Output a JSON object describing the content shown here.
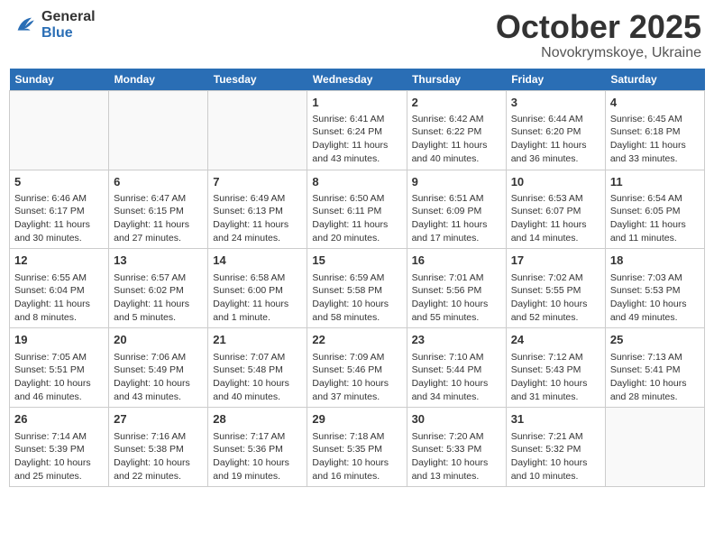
{
  "header": {
    "logo_general": "General",
    "logo_blue": "Blue",
    "month": "October 2025",
    "location": "Novokrymskoye, Ukraine"
  },
  "weekdays": [
    "Sunday",
    "Monday",
    "Tuesday",
    "Wednesday",
    "Thursday",
    "Friday",
    "Saturday"
  ],
  "weeks": [
    [
      {
        "day": "",
        "sunrise": "",
        "sunset": "",
        "daylight": ""
      },
      {
        "day": "",
        "sunrise": "",
        "sunset": "",
        "daylight": ""
      },
      {
        "day": "",
        "sunrise": "",
        "sunset": "",
        "daylight": ""
      },
      {
        "day": "1",
        "sunrise": "Sunrise: 6:41 AM",
        "sunset": "Sunset: 6:24 PM",
        "daylight": "Daylight: 11 hours and 43 minutes."
      },
      {
        "day": "2",
        "sunrise": "Sunrise: 6:42 AM",
        "sunset": "Sunset: 6:22 PM",
        "daylight": "Daylight: 11 hours and 40 minutes."
      },
      {
        "day": "3",
        "sunrise": "Sunrise: 6:44 AM",
        "sunset": "Sunset: 6:20 PM",
        "daylight": "Daylight: 11 hours and 36 minutes."
      },
      {
        "day": "4",
        "sunrise": "Sunrise: 6:45 AM",
        "sunset": "Sunset: 6:18 PM",
        "daylight": "Daylight: 11 hours and 33 minutes."
      }
    ],
    [
      {
        "day": "5",
        "sunrise": "Sunrise: 6:46 AM",
        "sunset": "Sunset: 6:17 PM",
        "daylight": "Daylight: 11 hours and 30 minutes."
      },
      {
        "day": "6",
        "sunrise": "Sunrise: 6:47 AM",
        "sunset": "Sunset: 6:15 PM",
        "daylight": "Daylight: 11 hours and 27 minutes."
      },
      {
        "day": "7",
        "sunrise": "Sunrise: 6:49 AM",
        "sunset": "Sunset: 6:13 PM",
        "daylight": "Daylight: 11 hours and 24 minutes."
      },
      {
        "day": "8",
        "sunrise": "Sunrise: 6:50 AM",
        "sunset": "Sunset: 6:11 PM",
        "daylight": "Daylight: 11 hours and 20 minutes."
      },
      {
        "day": "9",
        "sunrise": "Sunrise: 6:51 AM",
        "sunset": "Sunset: 6:09 PM",
        "daylight": "Daylight: 11 hours and 17 minutes."
      },
      {
        "day": "10",
        "sunrise": "Sunrise: 6:53 AM",
        "sunset": "Sunset: 6:07 PM",
        "daylight": "Daylight: 11 hours and 14 minutes."
      },
      {
        "day": "11",
        "sunrise": "Sunrise: 6:54 AM",
        "sunset": "Sunset: 6:05 PM",
        "daylight": "Daylight: 11 hours and 11 minutes."
      }
    ],
    [
      {
        "day": "12",
        "sunrise": "Sunrise: 6:55 AM",
        "sunset": "Sunset: 6:04 PM",
        "daylight": "Daylight: 11 hours and 8 minutes."
      },
      {
        "day": "13",
        "sunrise": "Sunrise: 6:57 AM",
        "sunset": "Sunset: 6:02 PM",
        "daylight": "Daylight: 11 hours and 5 minutes."
      },
      {
        "day": "14",
        "sunrise": "Sunrise: 6:58 AM",
        "sunset": "Sunset: 6:00 PM",
        "daylight": "Daylight: 11 hours and 1 minute."
      },
      {
        "day": "15",
        "sunrise": "Sunrise: 6:59 AM",
        "sunset": "Sunset: 5:58 PM",
        "daylight": "Daylight: 10 hours and 58 minutes."
      },
      {
        "day": "16",
        "sunrise": "Sunrise: 7:01 AM",
        "sunset": "Sunset: 5:56 PM",
        "daylight": "Daylight: 10 hours and 55 minutes."
      },
      {
        "day": "17",
        "sunrise": "Sunrise: 7:02 AM",
        "sunset": "Sunset: 5:55 PM",
        "daylight": "Daylight: 10 hours and 52 minutes."
      },
      {
        "day": "18",
        "sunrise": "Sunrise: 7:03 AM",
        "sunset": "Sunset: 5:53 PM",
        "daylight": "Daylight: 10 hours and 49 minutes."
      }
    ],
    [
      {
        "day": "19",
        "sunrise": "Sunrise: 7:05 AM",
        "sunset": "Sunset: 5:51 PM",
        "daylight": "Daylight: 10 hours and 46 minutes."
      },
      {
        "day": "20",
        "sunrise": "Sunrise: 7:06 AM",
        "sunset": "Sunset: 5:49 PM",
        "daylight": "Daylight: 10 hours and 43 minutes."
      },
      {
        "day": "21",
        "sunrise": "Sunrise: 7:07 AM",
        "sunset": "Sunset: 5:48 PM",
        "daylight": "Daylight: 10 hours and 40 minutes."
      },
      {
        "day": "22",
        "sunrise": "Sunrise: 7:09 AM",
        "sunset": "Sunset: 5:46 PM",
        "daylight": "Daylight: 10 hours and 37 minutes."
      },
      {
        "day": "23",
        "sunrise": "Sunrise: 7:10 AM",
        "sunset": "Sunset: 5:44 PM",
        "daylight": "Daylight: 10 hours and 34 minutes."
      },
      {
        "day": "24",
        "sunrise": "Sunrise: 7:12 AM",
        "sunset": "Sunset: 5:43 PM",
        "daylight": "Daylight: 10 hours and 31 minutes."
      },
      {
        "day": "25",
        "sunrise": "Sunrise: 7:13 AM",
        "sunset": "Sunset: 5:41 PM",
        "daylight": "Daylight: 10 hours and 28 minutes."
      }
    ],
    [
      {
        "day": "26",
        "sunrise": "Sunrise: 7:14 AM",
        "sunset": "Sunset: 5:39 PM",
        "daylight": "Daylight: 10 hours and 25 minutes."
      },
      {
        "day": "27",
        "sunrise": "Sunrise: 7:16 AM",
        "sunset": "Sunset: 5:38 PM",
        "daylight": "Daylight: 10 hours and 22 minutes."
      },
      {
        "day": "28",
        "sunrise": "Sunrise: 7:17 AM",
        "sunset": "Sunset: 5:36 PM",
        "daylight": "Daylight: 10 hours and 19 minutes."
      },
      {
        "day": "29",
        "sunrise": "Sunrise: 7:18 AM",
        "sunset": "Sunset: 5:35 PM",
        "daylight": "Daylight: 10 hours and 16 minutes."
      },
      {
        "day": "30",
        "sunrise": "Sunrise: 7:20 AM",
        "sunset": "Sunset: 5:33 PM",
        "daylight": "Daylight: 10 hours and 13 minutes."
      },
      {
        "day": "31",
        "sunrise": "Sunrise: 7:21 AM",
        "sunset": "Sunset: 5:32 PM",
        "daylight": "Daylight: 10 hours and 10 minutes."
      },
      {
        "day": "",
        "sunrise": "",
        "sunset": "",
        "daylight": ""
      }
    ]
  ]
}
